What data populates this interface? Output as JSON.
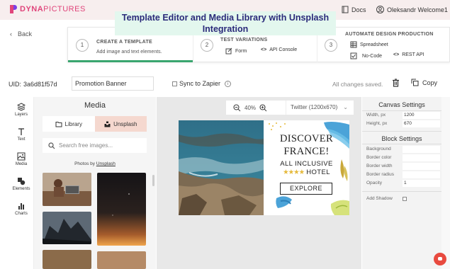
{
  "brand": {
    "name_bold": "DYNA",
    "name_rest": "PICTURES"
  },
  "header": {
    "docs_label": "Docs",
    "user_label": "Oleksandr Welcome1"
  },
  "overlay_title": "Template Editor and Media Library with Unsplash Integration",
  "back_label": "Back",
  "steps": [
    {
      "num": "1",
      "title": "CREATE A TEMPLATE",
      "sub": "Add image and text elements."
    },
    {
      "num": "2",
      "title": "TEST VARIATIONS",
      "items": [
        "Form",
        "API Console"
      ]
    },
    {
      "num": "3",
      "title": "AUTOMATE DESIGN PRODUCTION",
      "items": [
        "Spreadsheet",
        "No-Code",
        "REST API"
      ]
    }
  ],
  "template": {
    "uid_label": "UID:",
    "uid_value": "3a6d81f57d",
    "name_value": "Promotion Banner",
    "sync_label": "Sync to Zapier",
    "info_icon": "i",
    "status": "All changes saved.",
    "copy_label": "Copy"
  },
  "tools": [
    {
      "label": "Layers",
      "icon": "layers-icon"
    },
    {
      "label": "Text",
      "icon": "text-icon"
    },
    {
      "label": "Media",
      "icon": "image-icon"
    },
    {
      "label": "Elements",
      "icon": "shapes-icon"
    },
    {
      "label": "Charts",
      "icon": "chart-icon"
    }
  ],
  "media": {
    "title": "Media",
    "tab_library": "Library",
    "tab_unsplash": "Unsplash",
    "search_placeholder": "Search free images...",
    "photos_by": "Photos by",
    "photos_source": "Unsplash"
  },
  "canvas": {
    "zoom": "40%",
    "size_option": "Twitter (1200x670)",
    "design": {
      "line1": "DISCOVER",
      "line2": "FRANCE!",
      "line3": "ALL INCLUSIVE",
      "stars": "★★★★",
      "line4": "HOTEL",
      "button": "EXPLORE"
    }
  },
  "canvas_settings": {
    "title": "Canvas Settings",
    "width_label": "Width, px",
    "width_value": "1200",
    "height_label": "Height, px",
    "height_value": "670"
  },
  "block_settings": {
    "title": "Block Settings",
    "background_label": "Background",
    "border_color_label": "Border color",
    "border_width_label": "Border width",
    "border_radius_label": "Border radius",
    "opacity_label": "Opacity",
    "opacity_value": "1",
    "shadow_label": "Add Shadow"
  },
  "colors": {
    "accent": "#e0457b",
    "step_active": "#3aa66f",
    "unsplash_tab": "#f5d8cf"
  }
}
